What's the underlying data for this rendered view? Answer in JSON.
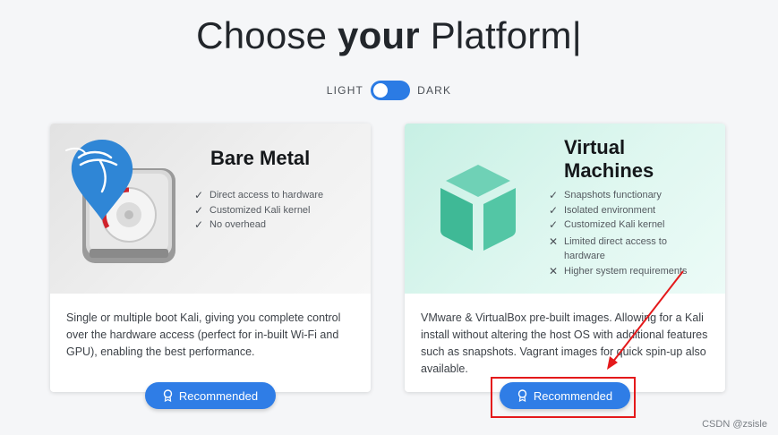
{
  "header": {
    "title_start": "Choose ",
    "title_bold": "your",
    "title_end": " Platform",
    "cursor": "|"
  },
  "theme_toggle": {
    "light_label": "LIGHT",
    "dark_label": "DARK",
    "state": "dark"
  },
  "cards": [
    {
      "title": "Bare Metal",
      "icon": "kali-boot-drive-icon",
      "features": [
        {
          "type": "check",
          "text": "Direct access to hardware"
        },
        {
          "type": "check",
          "text": "Customized Kali kernel"
        },
        {
          "type": "check",
          "text": "No overhead"
        }
      ],
      "description": "Single or multiple boot Kali, giving you complete control over the hardware access (perfect for in-built Wi-Fi and GPU), enabling the best performance.",
      "button_label": "Recommended"
    },
    {
      "title_line1": "Virtual",
      "title_line2": "Machines",
      "icon": "virtual-machine-cube-icon",
      "features": [
        {
          "type": "check",
          "text": "Snapshots functionary"
        },
        {
          "type": "check",
          "text": "Isolated environment"
        },
        {
          "type": "check",
          "text": "Customized Kali kernel"
        },
        {
          "type": "cross",
          "text": "Limited direct access to hardware"
        },
        {
          "type": "cross",
          "text": "Higher system requirements"
        }
      ],
      "description": "VMware & VirtualBox pre-built images. Allowing for a Kali install without altering the host OS with additional features such as snapshots. Vagrant images for quick spin-up also available.",
      "button_label": "Recommended"
    }
  ],
  "colors": {
    "accent": "#2f7de6",
    "annotation": "#e4191b",
    "vm_tint": "#dff7f0",
    "bm_tint": "#ececec"
  },
  "watermark": "CSDN @zsisle"
}
